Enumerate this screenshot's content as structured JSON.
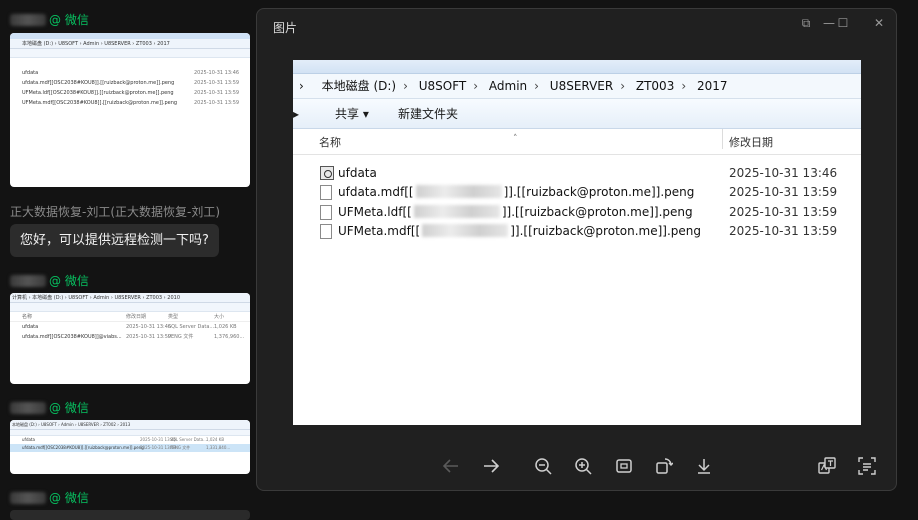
{
  "chat": {
    "messages": [
      {
        "sender_suffix": "@ 微信"
      },
      {
        "thumb": {
          "path": "本地磁盘 (D:) › U8SOFT › Admin › U8SERVER › ZT003 › 2017",
          "rows": [
            {
              "name": "ufdata",
              "date": "2025-10-31 13:46"
            },
            {
              "name": "ufdata.mdf[[OSC2038#KOU8]].[[ruizback@proton.me]].peng",
              "date": "2025-10-31 13:59"
            },
            {
              "name": "UFMeta.ldf[[OSC2038#KOU8]].[[ruizback@proton.me]].peng",
              "date": "2025-10-31 13:59"
            },
            {
              "name": "UFMeta.mdf[[OSC2038#KOU8]].[[ruizback@proton.me]].peng",
              "date": "2025-10-31 13:59"
            }
          ]
        }
      },
      {
        "nickname": "正大数据恢复-刘工(正大数据恢复-刘工)",
        "text": "您好，可以提供远程检测一下吗?"
      },
      {
        "sender_suffix": "@ 微信"
      },
      {
        "thumb": {
          "path": "计算机 › 本地磁盘 (D:) › U8SOFT › Admin › U8SERVER › ZT003 › 2010",
          "header": [
            "名称",
            "修改日期",
            "类型",
            "大小"
          ],
          "rows": [
            {
              "name": "ufdata",
              "date": "2025-10-31 13:46",
              "type": "SQL Server Data...",
              "size": "1,026 KB"
            },
            {
              "name": "ufdata.mdf[[OSC2038#KOU8]]@viabs...",
              "date": "2025-10-31 13:59",
              "type": "PENG 文件",
              "size": "1,376,960..."
            }
          ]
        }
      },
      {
        "sender_suffix": "@ 微信"
      },
      {
        "thumb": {
          "path": "本地磁盘 (D:) › U8SOFT › Admin › U8SERVER › ZT002 › 2013",
          "rows": [
            {
              "name": "ufdata",
              "date": "2025-10-31 13:46",
              "type": "SQL Server Data...",
              "size": "1,024 KB"
            },
            {
              "name": "ufdata.mdf[[OSC2038#KOU8]].[[ruizback@proton.me]].peng",
              "date": "2025-10-31 13:59",
              "type": "PENG 文件",
              "size": "1,331,840..."
            }
          ]
        }
      },
      {
        "sender_suffix": "@ 微信"
      }
    ]
  },
  "viewer": {
    "title": "图片",
    "controls": {
      "pin": "⧉",
      "minimize": "—",
      "maximize": "☐",
      "close": "✕"
    },
    "explorer": {
      "breadcrumb": [
        "本地磁盘 (D:)",
        "U8SOFT",
        "Admin",
        "U8SERVER",
        "ZT003",
        "2017"
      ],
      "toolbar": {
        "share": "共享 ▾",
        "new_folder": "新建文件夹"
      },
      "columns": {
        "name": "名称",
        "date": "修改日期"
      },
      "files": [
        {
          "name": "ufdata",
          "date": "2025-10-31 13:46"
        },
        {
          "name_pre": "ufdata.mdf[[",
          "name_post": "]].[[ruizback@proton.me]].peng",
          "date": "2025-10-31 13:59"
        },
        {
          "name_pre": "UFMeta.ldf[[",
          "name_post": "]].[[ruizback@proton.me]].peng",
          "date": "2025-10-31 13:59"
        },
        {
          "name_pre": "UFMeta.mdf[[",
          "name_post": "]].[[ruizback@proton.me]].peng",
          "date": "2025-10-31 13:59"
        }
      ]
    },
    "tool_icons": [
      "arrow-left-icon",
      "arrow-right-icon",
      "zoom-out-icon",
      "zoom-in-icon",
      "fit-screen-icon",
      "rotate-icon",
      "download-icon",
      "translate-icon",
      "text-extract-icon"
    ]
  },
  "colors": {
    "wechat_green": "#07c160",
    "viewer_bg": "#202020",
    "chat_bg": "#131313"
  }
}
